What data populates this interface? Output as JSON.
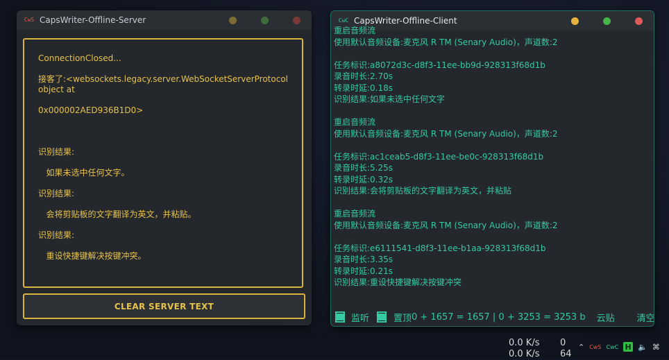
{
  "server": {
    "icon_text": "CwS",
    "title": "CapsWriter-Offline-Server",
    "text_lines": [
      "ConnectionClosed...",
      "",
      "接客了:<websockets.legacy.server.WebSocketServerProtocol",
      "object at",
      "",
      "0x000002AED936B1D0>",
      "",
      "",
      "",
      "识别结果:",
      "",
      "   如果未选中任何文字。",
      "",
      "识别结果:",
      "",
      "   会将剪贴板的文字翻译为英文，并粘贴。",
      "",
      "识别结果:",
      "",
      "   重设快捷键解决按键冲突。"
    ],
    "clear_button": "CLEAR SERVER TEXT"
  },
  "client": {
    "icon_text": "CwC",
    "title": "CapsWriter-Offline-Client",
    "log_lines": [
      "重启音频流",
      "使用默认音频设备:麦克风 R TM (Senary Audio)，声道数:2",
      "",
      "任务标识:a8072d3c-d8f3-11ee-bb9d-928313f68d1b",
      "录音时长:2.70s",
      "转录时延:0.18s",
      "识别结果:如果未选中任何文字",
      "",
      "重启音频流",
      "使用默认音频设备:麦克风 R TM (Senary Audio)，声道数:2",
      "",
      "任务标识:ac1ceab5-d8f3-11ee-be0c-928313f68d1b",
      "录音时长:5.25s",
      "转录时延:0.32s",
      "识别结果:会将剪贴板的文字翻译为英文，并粘贴",
      "",
      "重启音频流",
      "使用默认音频设备:麦克风 R TM (Senary Audio)，声道数:2",
      "",
      "任务标识:e6111541-d8f3-11ee-b1aa-928313f68d1b",
      "录音时长:3.35s",
      "转录时延:0.21s",
      "识别结果:重设快捷键解决按键冲突"
    ],
    "bottom": {
      "monitor_label": "监听",
      "top_label": "置顶",
      "stats": "0 + 1657 = 1657  |  0 + 3253 = 3253 b",
      "cloud_paste": "云贴",
      "clear": "清空"
    }
  },
  "tray": {
    "net_up": "0.0 K/s",
    "net_down": "0.0 K/s",
    "val1": "0",
    "val2": "64",
    "icon_s": "CwS",
    "icon_c": "CwC",
    "icon_h": "H"
  },
  "colors": {
    "server_accent": "#e7c24a",
    "client_accent": "#35c9a4"
  }
}
